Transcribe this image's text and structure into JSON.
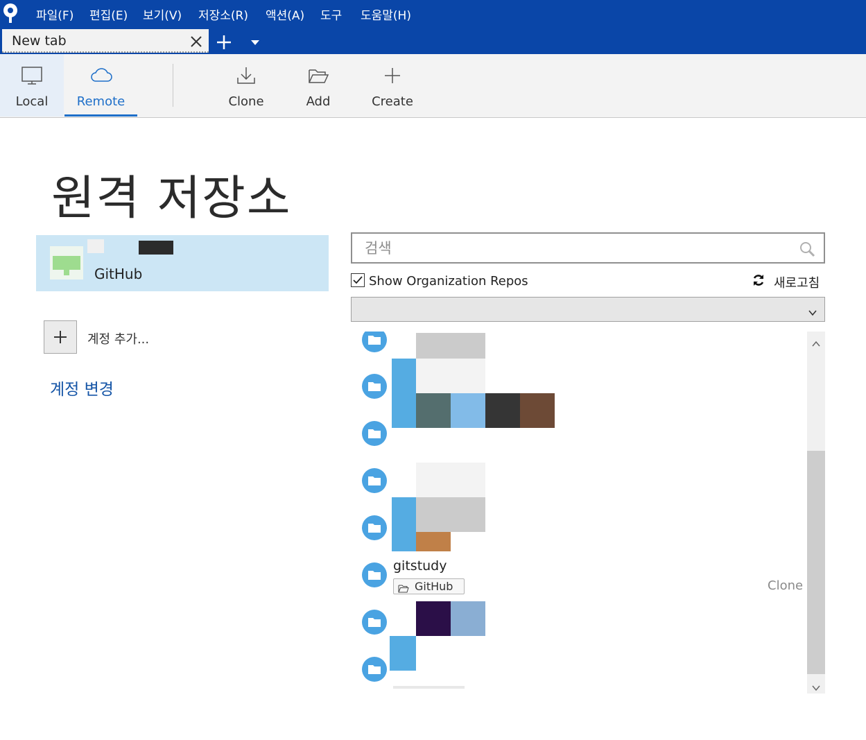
{
  "menu": {
    "items": [
      "파일(F)",
      "편집(E)",
      "보기(V)",
      "저장소(R)",
      "액션(A)",
      "도구",
      "도움말(H)"
    ]
  },
  "tabs": {
    "active_title": "New tab"
  },
  "toolbar": {
    "local_label": "Local",
    "remote_label": "Remote",
    "clone_label": "Clone",
    "add_label": "Add",
    "create_label": "Create",
    "active": "Remote"
  },
  "page": {
    "title": "원격 저장소"
  },
  "accounts": {
    "selected_service": "GitHub",
    "add_label": "계정 추가...",
    "change_label": "계정 변경"
  },
  "search": {
    "placeholder": "검색",
    "value": ""
  },
  "options": {
    "show_org_repos_label": "Show Organization Repos",
    "show_org_repos_checked": true,
    "refresh_label": "새로고침"
  },
  "filter": {
    "selected": ""
  },
  "repos": {
    "visible": {
      "name": "gitstudy",
      "source": "GitHub",
      "action_label": "Clone"
    }
  },
  "colors": {
    "title_bar": "#0a46a8",
    "accent": "#1e6fc9",
    "selected_account": "#cce6f5",
    "repo_icon": "#4aa3e2"
  }
}
